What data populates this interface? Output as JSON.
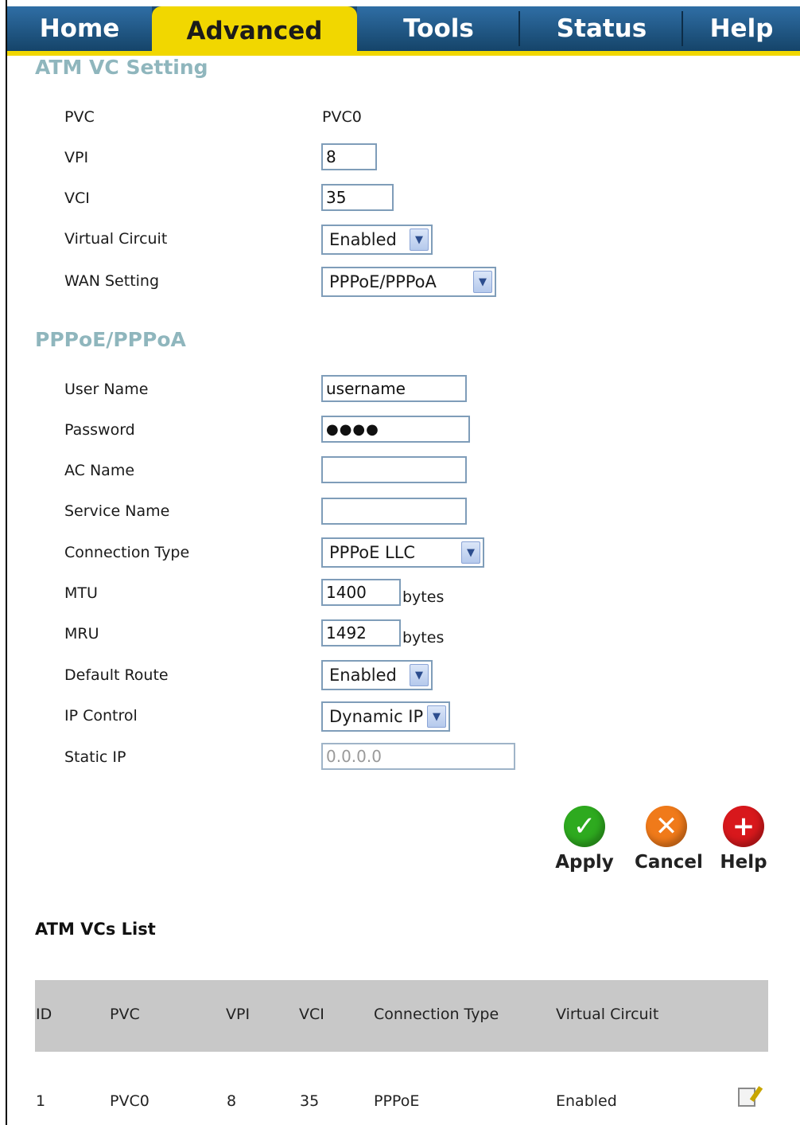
{
  "tabs": [
    {
      "label": "Home"
    },
    {
      "label": "Advanced"
    },
    {
      "label": "Tools"
    },
    {
      "label": "Status"
    },
    {
      "label": "Help"
    }
  ],
  "atm": {
    "title": "ATM VC Setting",
    "pvc_label": "PVC",
    "pvc_value": "PVC0",
    "vpi_label": "VPI",
    "vpi_value": "8",
    "vci_label": "VCI",
    "vci_value": "35",
    "vc_label": "Virtual Circuit",
    "vc_value": "Enabled",
    "wan_label": "WAN Setting",
    "wan_value": "PPPoE/PPPoA"
  },
  "pppoe": {
    "title": "PPPoE/PPPoA",
    "user_label": "User Name",
    "user_value": "username",
    "pass_label": "Password",
    "pass_value": "●●●●",
    "ac_label": "AC Name",
    "ac_value": "",
    "service_label": "Service Name",
    "service_value": "",
    "conn_label": "Connection Type",
    "conn_value": "PPPoE LLC",
    "mtu_label": "MTU",
    "mtu_value": "1400",
    "mtu_unit": "bytes",
    "mru_label": "MRU",
    "mru_value": "1492",
    "mru_unit": "bytes",
    "route_label": "Default Route",
    "route_value": "Enabled",
    "ipctl_label": "IP Control",
    "ipctl_value": "Dynamic IP",
    "static_label": "Static IP",
    "static_value": "0.0.0.0"
  },
  "buttons": {
    "apply": "Apply",
    "cancel": "Cancel",
    "help": "Help"
  },
  "colors": {
    "tab_active": "#f1d700",
    "tab_bg": "#1a4a72",
    "section_title": "#8fb6bd",
    "apply": "#2eaa1f",
    "cancel": "#f07a1a",
    "help": "#d8181c"
  },
  "list": {
    "title": "ATM VCs List",
    "headers": [
      "ID",
      "PVC",
      "VPI",
      "VCI",
      "Connection Type",
      "Virtual Circuit"
    ],
    "rows": [
      [
        "1",
        "PVC0",
        "8",
        "35",
        "PPPoE",
        "Enabled"
      ]
    ]
  }
}
